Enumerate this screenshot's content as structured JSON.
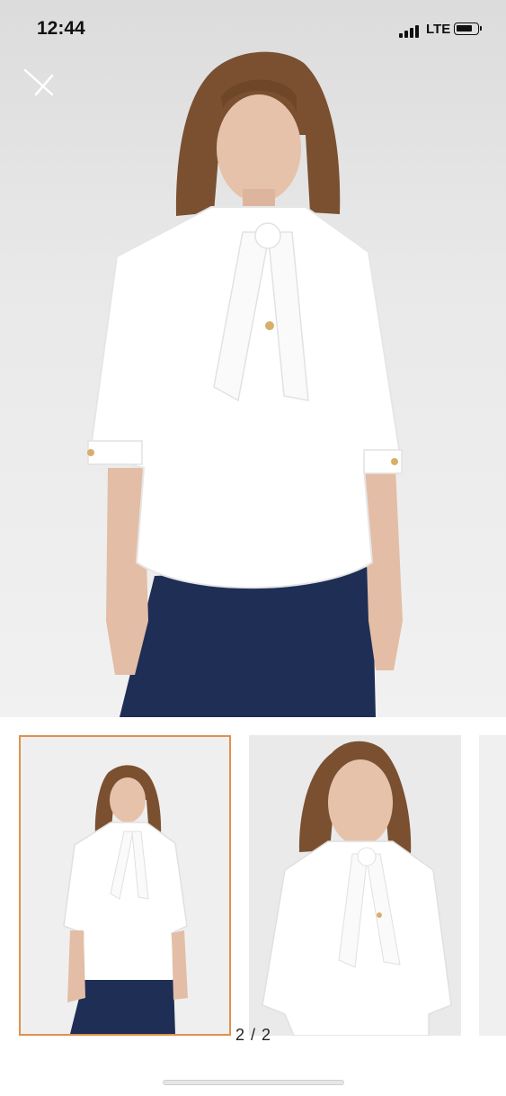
{
  "status_bar": {
    "time": "12:44",
    "network": "LTE"
  },
  "viewer": {
    "close_icon": "close-icon",
    "counter": "2 / 2"
  },
  "colors": {
    "selected_thumb_border": "#e0914b",
    "shirt": "#ffffff",
    "jeans": "#1e2e55",
    "hair": "#7a5030"
  }
}
